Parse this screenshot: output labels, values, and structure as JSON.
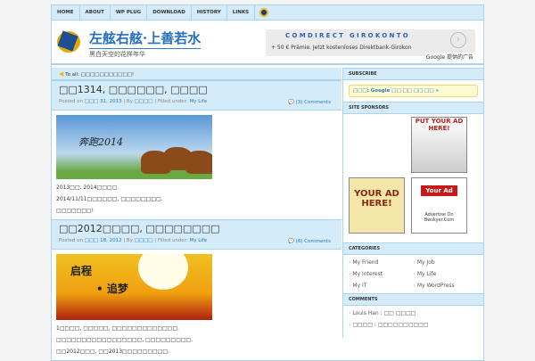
{
  "nav": [
    "HOME",
    "ABOUT",
    "WP PLUG",
    "DOWNLOAD",
    "HISTORY",
    "LINKS"
  ],
  "header": {
    "title": "左舷右舷·上善若水",
    "tagline": "黑白天空的花样年华"
  },
  "ad": {
    "title": "COMDIRECT GIROKONTO",
    "desc": "+ 50 € Prämie. Jetzt kostenloses Direktbank-Girokon",
    "google": "Google 提供的广告",
    "arrow": "›"
  },
  "notice": "To all: □□□□□□□□□□□!",
  "posts": [
    {
      "title": "□□1314, □□□□□□, □□□□",
      "posted": "Posted on",
      "date": "□□□ 31, 2013",
      "by": "| By",
      "author": "□□□□",
      "filed": "| Filled under:",
      "cat": "My Life",
      "comments": "(3) Comments",
      "img_text": "奔跑2014",
      "lines": [
        "2013□□, 2014□□□□.",
        "2014/11/11□□□□□□, □□□□□□□□.",
        "□□□□□□□!"
      ]
    },
    {
      "title": "□□2012□□□□, □□□□□□□□",
      "posted": "Posted on",
      "date": "□□□ 18, 2012",
      "by": "| By",
      "author": "□□□□",
      "filed": "| Filled under:",
      "cat": "My Life",
      "comments": "(6) Comments",
      "img_text": "启程",
      "img_text2": "• 追梦",
      "lines": [
        "1□□□□, □□□□□, □□□□□□□□□□□□□.",
        "□□□□□□□□□□□□□□□□□, □□□□□□□□□.",
        "□□2012□□□, □□2013□□□□□□□□□."
      ]
    }
  ],
  "sidebar": {
    "subscribe": {
      "heading": "SUBSCRIBE",
      "text": "□□□: Google  □□  □□  □□  □□ »"
    },
    "sponsors": {
      "heading": "SITE SPONSORS",
      "ads": [
        "PUT YOUR AD HERE!",
        "YOUR AD HERE!",
        "Your Ad",
        "Advertise On Bwskyer.Com"
      ]
    },
    "categories": {
      "heading": "CATEGORIES",
      "items": [
        "My Friend",
        "My Job",
        "My Interest",
        "My Life",
        "My IT",
        "My WordPress"
      ]
    },
    "comments": {
      "heading": "COMMENTS",
      "items": [
        "Louis Han : □□ □□□□",
        "□□□□ : □□□□□□□□□□"
      ]
    }
  }
}
